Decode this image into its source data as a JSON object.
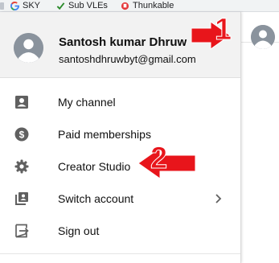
{
  "bookmarks": [
    {
      "label": "SKY",
      "icon": "google-icon"
    },
    {
      "label": "Sub VLEs",
      "icon": "checkmark-icon"
    },
    {
      "label": "Thunkable",
      "icon": "thunkable-icon"
    }
  ],
  "account": {
    "name": "Santosh kumar Dhruw",
    "email": "santoshdhruwbyt@gmail.com",
    "avatar_icon": "default-avatar-icon"
  },
  "menu": {
    "items": [
      {
        "label": "My channel",
        "icon": "account-box-icon"
      },
      {
        "label": "Paid memberships",
        "icon": "dollar-circle-icon"
      },
      {
        "label": "Creator Studio",
        "icon": "gear-icon"
      },
      {
        "label": "Switch account",
        "icon": "switch-account-icon",
        "has_submenu": true
      },
      {
        "label": "Sign out",
        "icon": "sign-out-icon"
      }
    ]
  },
  "annotations": {
    "arrow_1_number": "1",
    "arrow_2_number": "2",
    "color": "#e8151b"
  },
  "colors": {
    "header_bg": "#f2f2f2",
    "icon_gray": "#606060",
    "avatar_gray": "#8a939d"
  }
}
